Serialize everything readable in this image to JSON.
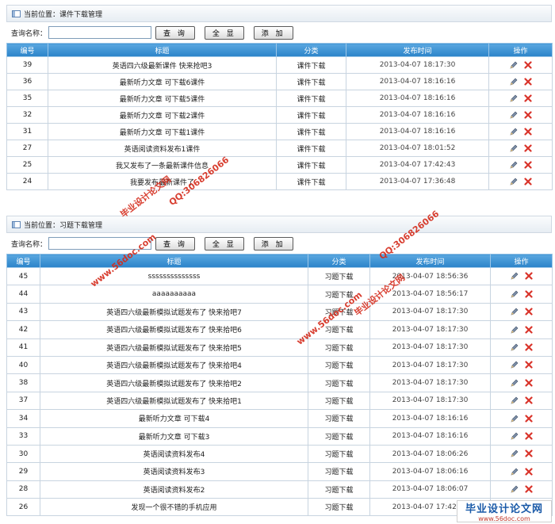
{
  "panel1": {
    "location": "当前位置：课件下载管理",
    "search_label": "查询名称：",
    "search_value": "",
    "btn_query": "查 询",
    "btn_all": "全 显",
    "btn_add": "添 加",
    "headers": [
      "编号",
      "标题",
      "分类",
      "发布时间",
      "操作"
    ],
    "rows": [
      {
        "id": "39",
        "title": "英语四六级最新课件 快来抢吧3",
        "cat": "课件下载",
        "date": "2013-04-07 18:17:30"
      },
      {
        "id": "36",
        "title": "最新听力文章 可下载6课件",
        "cat": "课件下载",
        "date": "2013-04-07 18:16:16"
      },
      {
        "id": "35",
        "title": "最新听力文章 可下载5课件",
        "cat": "课件下载",
        "date": "2013-04-07 18:16:16"
      },
      {
        "id": "32",
        "title": "最新听力文章 可下载2课件",
        "cat": "课件下载",
        "date": "2013-04-07 18:16:16"
      },
      {
        "id": "31",
        "title": "最新听力文章 可下载1课件",
        "cat": "课件下载",
        "date": "2013-04-07 18:16:16"
      },
      {
        "id": "27",
        "title": "英语阅读资料发布1课件",
        "cat": "课件下载",
        "date": "2013-04-07 18:01:52"
      },
      {
        "id": "25",
        "title": "我又发布了一条最新课件信息",
        "cat": "课件下载",
        "date": "2013-04-07 17:42:43"
      },
      {
        "id": "24",
        "title": "我要发布最新课件了",
        "cat": "课件下载",
        "date": "2013-04-07 17:36:48"
      }
    ]
  },
  "panel2": {
    "location": "当前位置：习题下载管理",
    "search_label": "查询名称：",
    "search_value": "",
    "btn_query": "查 询",
    "btn_all": "全 显",
    "btn_add": "添 加",
    "headers": [
      "编号",
      "标题",
      "分类",
      "发布时间",
      "操作"
    ],
    "rows": [
      {
        "id": "45",
        "title": "ssssssssssssss",
        "cat": "习题下载",
        "date": "2013-04-07 18:56:36"
      },
      {
        "id": "44",
        "title": "aaaaaaaaaa",
        "cat": "习题下载",
        "date": "2013-04-07 18:56:17"
      },
      {
        "id": "43",
        "title": "英语四六级最新模拟试题发布了 快来拾吧7",
        "cat": "习题下载",
        "date": "2013-04-07 18:17:30"
      },
      {
        "id": "42",
        "title": "英语四六级最新模拟试题发布了 快来拾吧6",
        "cat": "习题下载",
        "date": "2013-04-07 18:17:30"
      },
      {
        "id": "41",
        "title": "英语四六级最新模拟试题发布了 快来拾吧5",
        "cat": "习题下载",
        "date": "2013-04-07 18:17:30"
      },
      {
        "id": "40",
        "title": "英语四六级最新模拟试题发布了 快来拾吧4",
        "cat": "习题下载",
        "date": "2013-04-07 18:17:30"
      },
      {
        "id": "38",
        "title": "英语四六级最新模拟试题发布了 快来拾吧2",
        "cat": "习题下载",
        "date": "2013-04-07 18:17:30"
      },
      {
        "id": "37",
        "title": "英语四六级最新模拟试题发布了 快来拾吧1",
        "cat": "习题下载",
        "date": "2013-04-07 18:17:30"
      },
      {
        "id": "34",
        "title": "最新听力文章 可下载4",
        "cat": "习题下载",
        "date": "2013-04-07 18:16:16"
      },
      {
        "id": "33",
        "title": "最新听力文章 可下载3",
        "cat": "习题下载",
        "date": "2013-04-07 18:16:16"
      },
      {
        "id": "30",
        "title": "英语阅读资料发布4",
        "cat": "习题下载",
        "date": "2013-04-07 18:06:26"
      },
      {
        "id": "29",
        "title": "英语阅读资料发布3",
        "cat": "习题下载",
        "date": "2013-04-07 18:06:16"
      },
      {
        "id": "28",
        "title": "英语阅读资料发布2",
        "cat": "习题下载",
        "date": "2013-04-07 18:06:07"
      },
      {
        "id": "26",
        "title": "发现一个很不错的手机应用",
        "cat": "习题下载",
        "date": "2013-04-07 17:42:00"
      }
    ]
  },
  "icons": {
    "edit": "pencil-icon",
    "delete": "x-delete-icon",
    "location": "window-icon"
  },
  "colors": {
    "header_bg": "#3b93d4",
    "delete": "#d9342b",
    "edit": "#5b6f8c",
    "watermark": "#d42a1a"
  },
  "watermarks": [
    "毕业设计论文网",
    "QQ:306826066",
    "www.56doc.com"
  ],
  "footer_logo": {
    "title": "毕业设计论文网",
    "url": "www.56doc.com"
  }
}
